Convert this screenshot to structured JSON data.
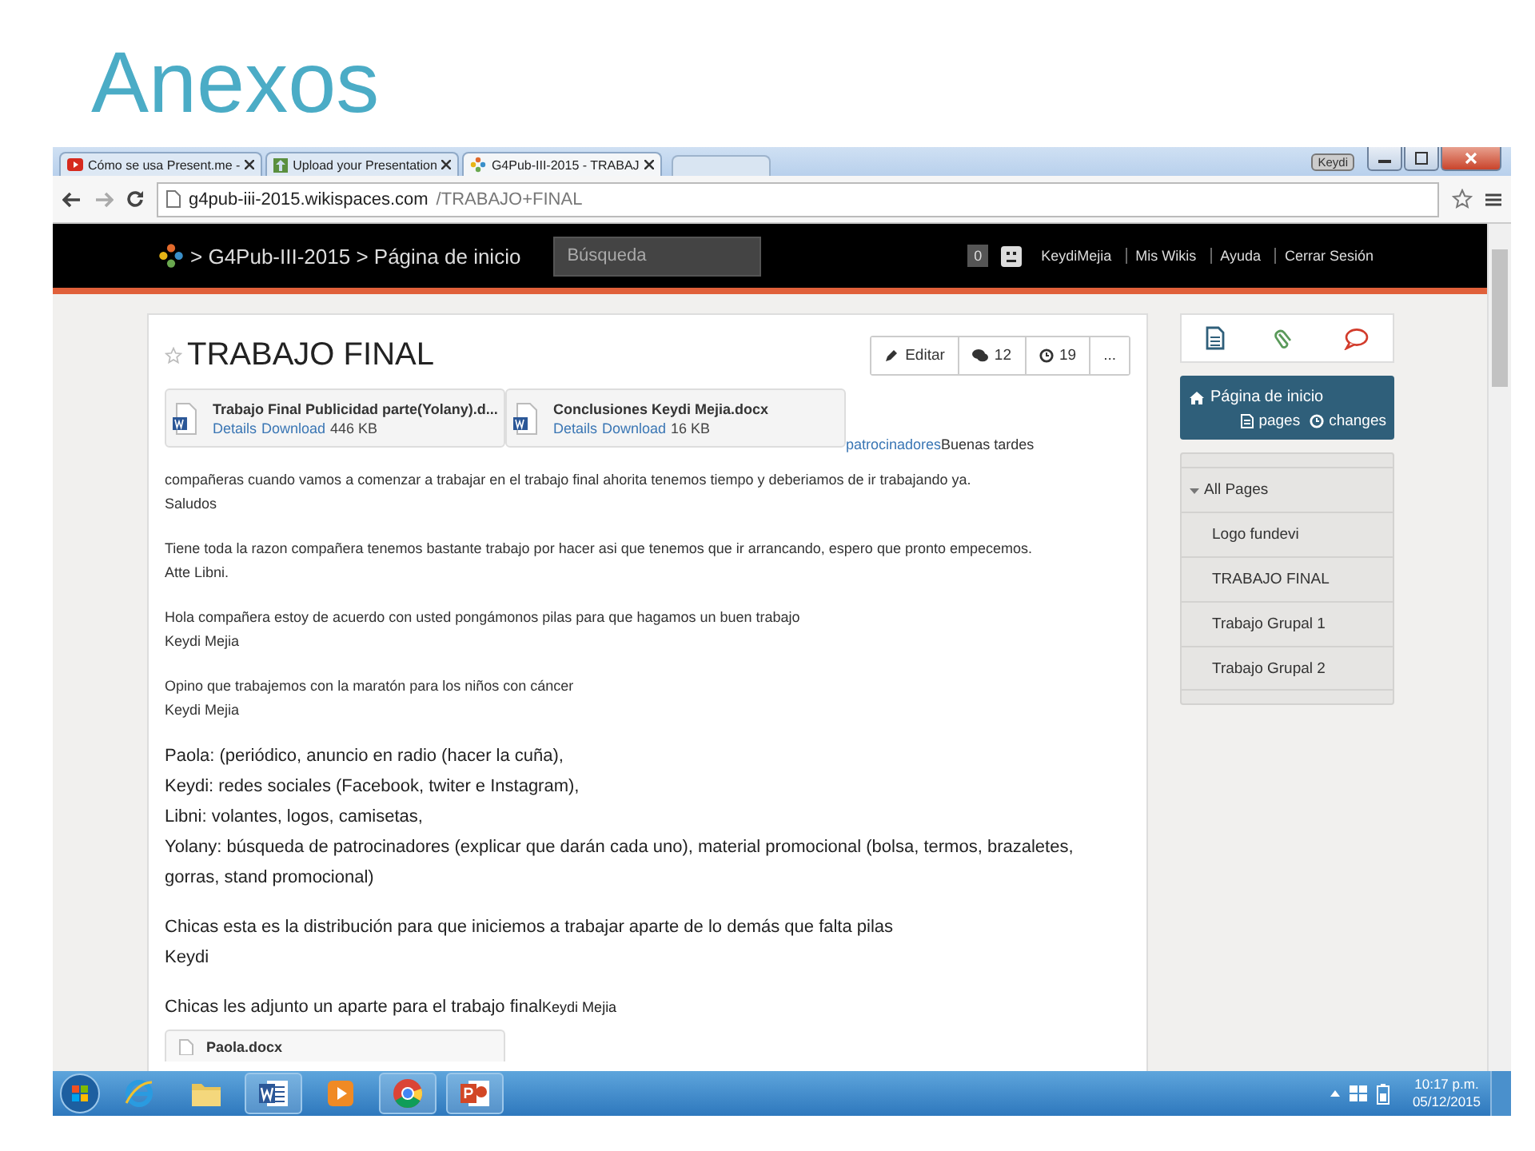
{
  "slide": {
    "title": "Anexos"
  },
  "browser": {
    "tabs": [
      {
        "title": "Cómo se usa Present.me -",
        "selected": false
      },
      {
        "title": "Upload your Presentation",
        "selected": false
      },
      {
        "title": "G4Pub-III-2015 - TRABAJ",
        "selected": true
      }
    ],
    "user_badge": "Keydi",
    "address": {
      "domain": "g4pub-iii-2015.wikispaces.com",
      "path": "/TRABAJO+FINAL"
    }
  },
  "site_header": {
    "breadcrumb": "> G4Pub-III-2015 > Página de inicio",
    "search": {
      "placeholder": "Búsqueda"
    },
    "notifications": "0",
    "user_links": [
      "KeydiMejia",
      "Mis Wikis",
      "Ayuda",
      "Cerrar Sesión"
    ]
  },
  "page": {
    "title": "TRABAJO FINAL",
    "favorite": false,
    "actions": [
      {
        "kind": "edit",
        "label": "Editar"
      },
      {
        "kind": "comments",
        "label": "12"
      },
      {
        "kind": "history",
        "label": "19"
      },
      {
        "kind": "more",
        "label": "..."
      }
    ],
    "files": [
      {
        "name": "Trabajo Final Publicidad parte(Yolany).d...",
        "links": [
          "Details",
          "Download"
        ],
        "size": "446 KB"
      },
      {
        "name": "Conclusiones Keydi Mejia.docx",
        "links": [
          "Details",
          "Download"
        ],
        "size": "16 KB"
      }
    ],
    "files_tail": {
      "link": "patrocinadores",
      "text": "Buenas tardes"
    },
    "paragraphs": [
      {
        "kind": "small",
        "lines": [
          "compañeras cuando vamos a comenzar a trabajar en el trabajo final ahorita tenemos tiempo y deberiamos de ir trabajando ya.",
          "Saludos"
        ]
      },
      {
        "kind": "small",
        "lines": [
          "Tiene toda la razon compañera tenemos bastante trabajo por hacer asi que tenemos que ir arrancando, espero que pronto empecemos.",
          "Atte Libni."
        ]
      },
      {
        "kind": "small",
        "lines": [
          "Hola compañera estoy de acuerdo con usted pongámonos pilas para que hagamos un buen trabajo",
          "Keydi Mejia"
        ]
      },
      {
        "kind": "small",
        "lines": [
          "Opino que trabajemos con la maratón para los niños con cáncer",
          "Keydi Mejia"
        ]
      },
      {
        "kind": "large",
        "lines": [
          "Paola: (periódico, anuncio en radio (hacer la cuña),",
          "Keydi: redes sociales (Facebook, twiter e Instagram),",
          "Libni: volantes, logos, camisetas,",
          "Yolany: búsqueda de patrocinadores (explicar que darán cada uno), material promocional (bolsa, termos, brazaletes,",
          "gorras, stand promocional)"
        ]
      },
      {
        "kind": "large",
        "lines": [
          "Chicas esta es la distribución para que iniciemos a trabajar aparte de lo demás que falta pilas",
          "Keydi"
        ]
      },
      {
        "kind": "large",
        "lines": [
          "Chicas les adjunto un aparte para el trabajo final"
        ],
        "signature": "Keydi Mejia"
      }
    ],
    "attachment": {
      "name": "Paola.docx"
    }
  },
  "sidebar": {
    "home": {
      "title": "Página de inicio",
      "links": [
        "pages",
        "changes"
      ]
    },
    "tree": {
      "label": "All Pages",
      "expanded": true,
      "children": [
        {
          "label": "Logo fundevi"
        },
        {
          "label": "TRABAJO FINAL"
        },
        {
          "label": "Trabajo Grupal 1"
        },
        {
          "label": "Trabajo Grupal 2"
        }
      ]
    }
  },
  "taskbar": {
    "apps": [
      {
        "kind": "ie",
        "running": false
      },
      {
        "kind": "folder",
        "running": false
      },
      {
        "kind": "word",
        "running": true
      },
      {
        "kind": "media",
        "running": false
      },
      {
        "kind": "chrome",
        "running": true
      },
      {
        "kind": "powerpoint",
        "running": true
      }
    ],
    "time": "10:17 p.m.",
    "date": "05/12/2015"
  }
}
